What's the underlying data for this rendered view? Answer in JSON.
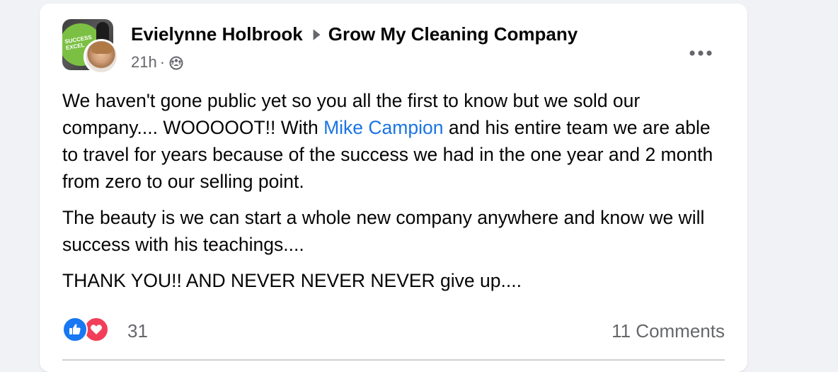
{
  "post": {
    "author": "Evielynne Holbrook",
    "group": "Grow My Cleaning Company",
    "timestamp": "21h",
    "separator": "·",
    "audience_icon": "group-audience-icon",
    "group_avatar_text": "SUCCESS EXCEL"
  },
  "body": {
    "p1_before": "We haven't gone public yet so you all the first to know but we sold our company.... WOOOOOT!! With ",
    "mention": "Mike Campion",
    "p1_after": " and his entire team we are able to travel for years because of the success we had in the one year and 2 month from zero to our selling point.",
    "p2": "The beauty is we can start a whole new company anywhere and know we will success with his teachings....",
    "p3": "THANK YOU!! AND NEVER NEVER NEVER give up...."
  },
  "footer": {
    "reaction_count": "31",
    "comments_label": "11 Comments",
    "reactions": [
      "like-icon",
      "love-icon"
    ]
  },
  "colors": {
    "link": "#1b74e4",
    "secondary_text": "#65676b",
    "like": "#1877f2",
    "love": "#f33e58"
  }
}
